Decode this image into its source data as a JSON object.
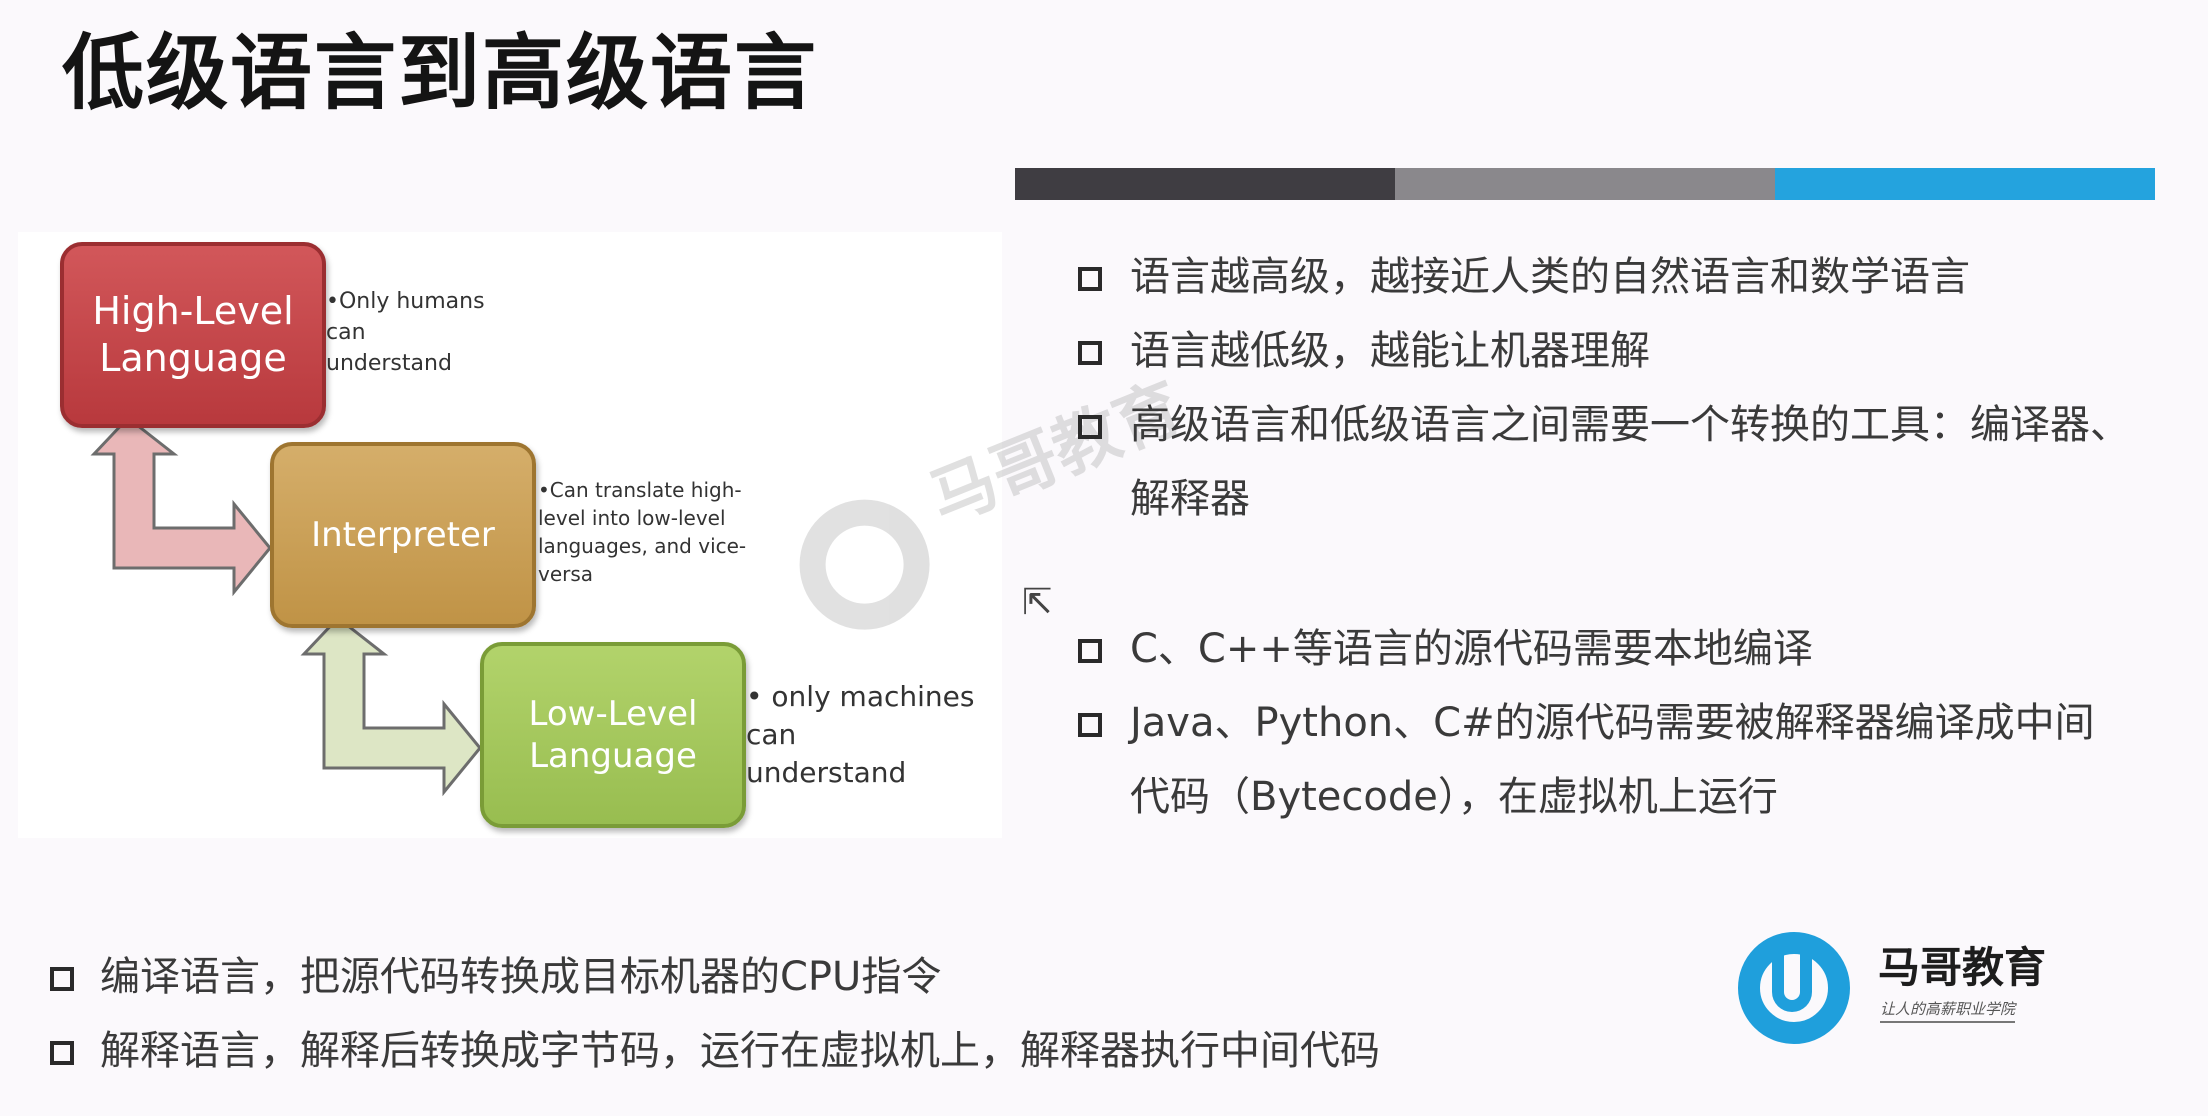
{
  "slide": {
    "title": "低级语言到高级语言",
    "accent_colors": [
      "#3f3d42",
      "#8a888c",
      "#24a3de"
    ]
  },
  "diagram": {
    "boxes": [
      {
        "line1": "High-Level",
        "line2": "Language",
        "color": "#c44a4d"
      },
      {
        "line1": "Interpreter",
        "line2": "",
        "color": "#cca15a"
      },
      {
        "line1": "Low-Level",
        "line2": "Language",
        "color": "#a6c95f"
      }
    ],
    "notes": [
      [
        "•Only humans",
        "can",
        "understand"
      ],
      [
        "•Can translate high-",
        "level into low-level",
        "languages, and vice-",
        "versa"
      ],
      [
        "• only machines",
        "can",
        "understand"
      ]
    ]
  },
  "watermark": {
    "text": "马哥教育",
    "icon": "mage-logo-icon"
  },
  "right_bullets": [
    {
      "lines": [
        "语言越高级，越接近人类的自然语言和数学语言"
      ]
    },
    {
      "lines": [
        "语言越低级，越能让机器理解"
      ]
    },
    {
      "lines": [
        "高级语言和低级语言之间需要一个转换的工具：编译器、",
        "解释器"
      ]
    },
    {
      "lines": [
        "C、C++等语言的源代码需要本地编译"
      ]
    },
    {
      "lines": [
        "Java、Python、C#的源代码需要被解释器编译成中间",
        "代码（Bytecode），在虚拟机上运行"
      ]
    }
  ],
  "bottom_bullets": [
    "编译语言，把源代码转换成目标机器的CPU指令",
    "解释语言，解释后转换成字节码，运行在虚拟机上，解释器执行中间代码"
  ],
  "brand": {
    "name": "马哥教育",
    "slogan": "让人的高薪职业学院",
    "color": "#1f9fdc"
  }
}
